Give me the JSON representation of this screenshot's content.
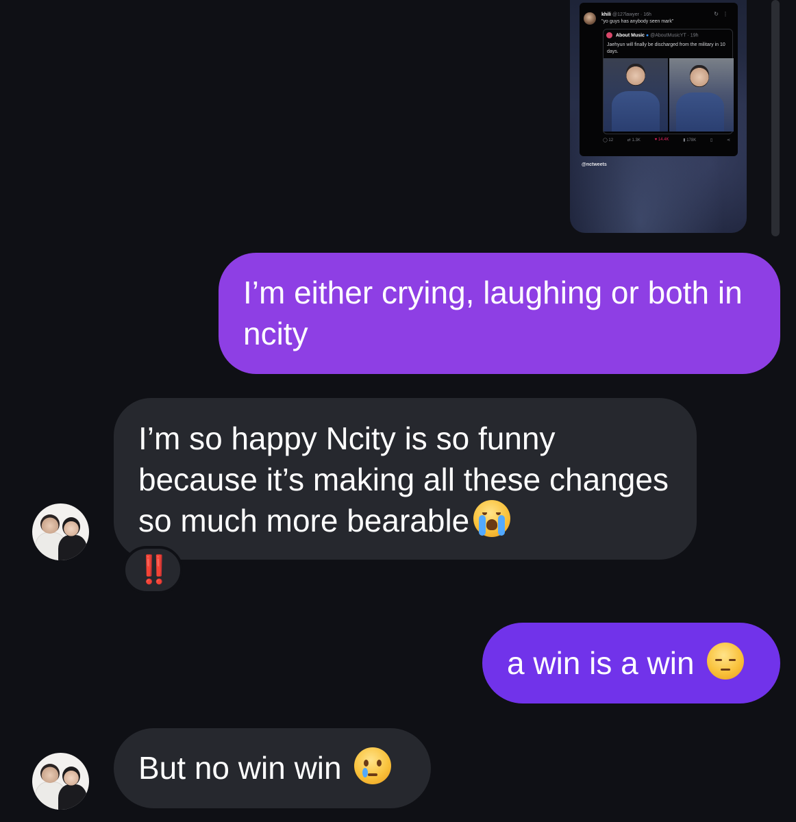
{
  "shared_post": {
    "tweet": {
      "display_name": "khili",
      "handle_time": "@127lawyer · 16h",
      "text": "\"yo guys has anybody seen mark\"",
      "icons": [
        "refresh-icon",
        "more-icon"
      ],
      "quoted": {
        "display_name": "About Music",
        "handle_time": "@AboutMusicYT · 19h",
        "text": "Jaehyun will finally be discharged from the military in 10 days."
      },
      "stats": {
        "replies": "12",
        "retweets": "1.3K",
        "likes": "14.4K",
        "views": "178K"
      }
    },
    "source_handle": "@nctweets"
  },
  "messages": [
    {
      "id": "sent-1",
      "direction": "sent",
      "text": "I’m either crying, laughing  or both in ncity"
    },
    {
      "id": "recv-1",
      "direction": "received",
      "text": "I’m so happy Ncity is so funny because it’s making all these changes so much more bearable",
      "emoji": "loudly-crying-face",
      "reaction": "‼️"
    },
    {
      "id": "sent-2",
      "direction": "sent",
      "text": "a win is a win",
      "emoji": "pensive-face"
    },
    {
      "id": "recv-2",
      "direction": "received",
      "text": "But no win win",
      "emoji": "face-holding-back-tears"
    }
  ],
  "colors": {
    "background": "#0f1015",
    "sent_bubble_1": "#8e3fe4",
    "sent_bubble_2": "#7133ea",
    "received_bubble": "#26282e",
    "reaction": "#e0242c"
  }
}
